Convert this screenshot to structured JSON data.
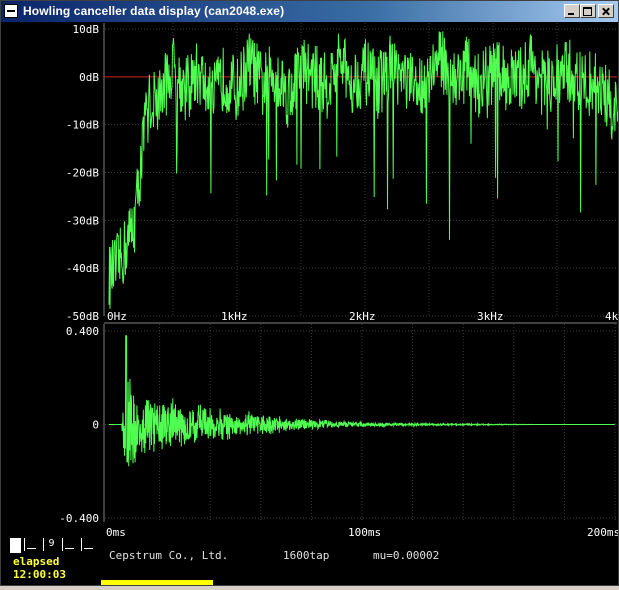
{
  "window": {
    "title": "Howling canceller data display (can2048.exe)",
    "controls": {
      "minimize": "minimize",
      "maximize": "maximize",
      "close": "close"
    }
  },
  "colors": {
    "trace": "#50ff50",
    "grid": "#3a3a3a",
    "reference_line": "#cc2020",
    "axis_text": "#ffffff",
    "elapsed_text": "#ffff40",
    "progress": "#ffff00"
  },
  "spectrum": {
    "y_ticks": [
      "10dB",
      "0dB",
      "-10dB",
      "-20dB",
      "-30dB",
      "-40dB",
      "-50dB"
    ],
    "x_ticks": [
      "0Hz",
      "1kHz",
      "2kHz",
      "3kHz",
      "4kHz"
    ],
    "reference_level": "0dB"
  },
  "impulse": {
    "y_ticks": [
      "0.400",
      "0",
      "-0.400"
    ],
    "x_ticks": [
      "0ms",
      "100ms",
      "200ms"
    ]
  },
  "status": {
    "mode_icons": [
      "stop-icon",
      "step-icon",
      "9",
      "mode-a-icon",
      "mode-b-icon"
    ],
    "mode_number": "9",
    "elapsed_label": "elapsed",
    "elapsed_time": "12:00:03",
    "company": "Cepstrum Co., Ltd.",
    "taps": "1600tap",
    "mu": "mu=0.00002"
  },
  "chart_data": [
    {
      "type": "line",
      "title": "",
      "xlabel": "",
      "ylabel": "",
      "xlim": [
        0,
        4000
      ],
      "ylim": [
        -50,
        10
      ],
      "x_unit": "Hz",
      "y_unit": "dB",
      "grid": true,
      "reference_line": 0,
      "series": [
        {
          "x": [
            0,
            100,
            200,
            300,
            400,
            500,
            600,
            700,
            800,
            900,
            1000,
            1100,
            1200,
            1300,
            1400,
            1500,
            1600,
            1700,
            1800,
            1900,
            2000,
            2100,
            2200,
            2300,
            2400,
            2500,
            2600,
            2700,
            2800,
            2900,
            3000,
            3100,
            3200,
            3300,
            3400,
            3500,
            3600,
            3700,
            3800,
            3900,
            4000
          ],
          "values": [
            -42,
            -38,
            -30,
            -6,
            -4,
            2,
            -3,
            1,
            -5,
            0,
            -3,
            3,
            -2,
            1,
            -4,
            2,
            0,
            -2,
            3,
            -1,
            1,
            -2,
            2,
            0,
            -3,
            1,
            4,
            -1,
            2,
            -2,
            1,
            0,
            -1,
            3,
            -2,
            0,
            1,
            -2,
            -1,
            -5,
            -10
          ]
        }
      ]
    },
    {
      "type": "line",
      "title": "",
      "xlabel": "",
      "ylabel": "",
      "xlim": [
        0,
        200
      ],
      "ylim": [
        -0.4,
        0.4
      ],
      "x_unit": "ms",
      "grid": true,
      "series": [
        {
          "x": [
            0,
            5,
            7,
            10,
            15,
            20,
            25,
            30,
            35,
            40,
            45,
            50,
            55,
            60,
            65,
            70,
            75,
            80,
            85,
            90,
            95,
            100,
            110,
            120,
            130,
            140,
            150,
            160,
            170,
            180,
            190,
            200
          ],
          "values": [
            0,
            0,
            0.38,
            0.14,
            0.12,
            0.1,
            0.1,
            0.08,
            0.08,
            0.07,
            0.06,
            0.05,
            0.05,
            0.04,
            0.035,
            0.03,
            0.025,
            0.02,
            0.018,
            0.015,
            0.012,
            0.01,
            0.008,
            0.006,
            0.004,
            0.003,
            0.002,
            0.001,
            0,
            0,
            0,
            0
          ]
        }
      ]
    }
  ]
}
